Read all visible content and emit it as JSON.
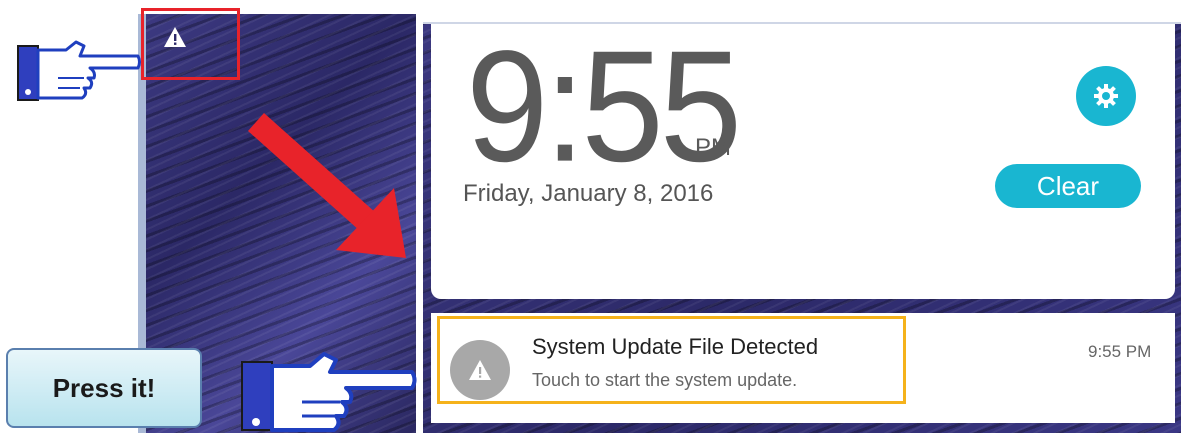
{
  "clock": {
    "hour_min": "9:55",
    "ampm": "PM",
    "date": "Friday, January 8, 2016"
  },
  "controls": {
    "clear_label": "Clear",
    "settings_icon": "gear-icon"
  },
  "notification": {
    "title": "System Update File Detected",
    "text": "Touch to start the system update.",
    "time": "9:55 PM",
    "icon": "warning-icon"
  },
  "status_bar": {
    "icon": "warning-icon"
  },
  "annotation": {
    "press_label": "Press it!"
  },
  "colors": {
    "accent": "#19b6d1",
    "highlight_red": "#e8232a",
    "highlight_yellow": "#f5b21b",
    "wallpaper": "#2c2968"
  }
}
